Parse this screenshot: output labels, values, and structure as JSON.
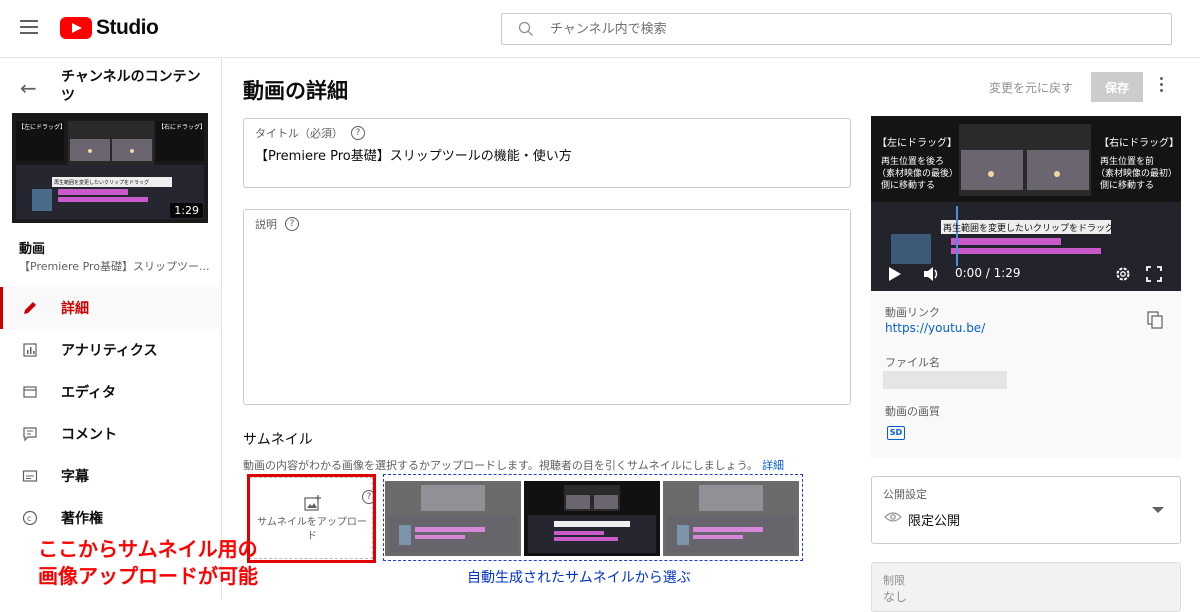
{
  "app": {
    "logo_text": "Studio",
    "brand_color": "#ff0000"
  },
  "search": {
    "placeholder": "チャンネル内で検索"
  },
  "sidebar": {
    "section_title": "チャンネルのコンテンツ",
    "video_duration": "1:29",
    "video_heading": "動画",
    "video_title": "【Premiere Pro基礎】スリップツー...",
    "items": [
      {
        "label": "詳細",
        "icon": "pencil-icon",
        "active": true
      },
      {
        "label": "アナリティクス",
        "icon": "analytics-icon",
        "active": false
      },
      {
        "label": "エディタ",
        "icon": "editor-icon",
        "active": false
      },
      {
        "label": "コメント",
        "icon": "comment-icon",
        "active": false
      },
      {
        "label": "字幕",
        "icon": "subtitles-icon",
        "active": false
      },
      {
        "label": "著作権",
        "icon": "copyright-icon",
        "active": false
      }
    ],
    "active_color": "#cc0000"
  },
  "main": {
    "page_title": "動画の詳細",
    "undo_label": "変更を元に戻す",
    "save_label": "保存",
    "title_field": {
      "label": "タイトル（必須）",
      "value": "【Premiere Pro基礎】スリップツールの機能・使い方"
    },
    "description_field": {
      "label": "説明",
      "value": ""
    },
    "thumbnail": {
      "heading": "サムネイル",
      "description": "動画の内容がわかる画像を選択するかアップロードします。視聴者の目を引くサムネイルにしましょう。",
      "more_link": "詳細",
      "upload_label": "サムネイルをアップロード"
    },
    "annotation_red": [
      "ここからサムネイル用の",
      "画像アップロードが可能"
    ],
    "annotation_blue": "自動生成されたサムネイルから選ぶ"
  },
  "thumb_overlay": {
    "left_drag": "【左にドラッグ】",
    "left_desc": [
      "再生位置を後ろ",
      "（素材映像の最後）",
      "側に移動する"
    ],
    "right_drag": "【右にドラッグ】",
    "right_desc": [
      "再生位置を前",
      "（素材映像の最初）",
      "側に移動する"
    ],
    "caption": "再生範囲を変更したいクリップをドラッグ"
  },
  "preview": {
    "timecode": "0:00 / 1:29",
    "link_label": "動画リンク",
    "link_value": "https://youtu.be/",
    "file_label": "ファイル名",
    "quality_label": "動画の画質",
    "quality_badge": "SD"
  },
  "visibility": {
    "label": "公開設定",
    "value": "限定公開"
  },
  "restriction": {
    "label": "制限",
    "value": "なし"
  },
  "colors": {
    "link": "#065fd4",
    "annotation_red": "#ff0000",
    "annotation_blue": "#0033cc"
  }
}
